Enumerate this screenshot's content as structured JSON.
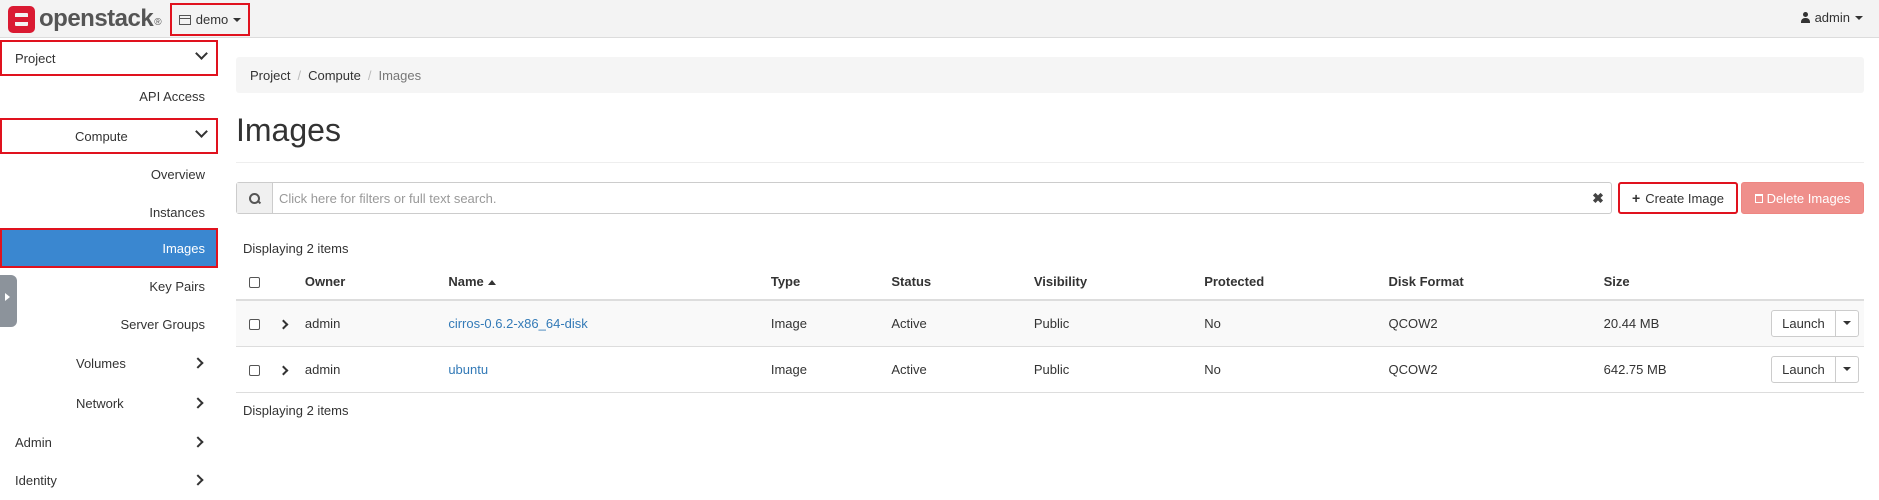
{
  "topbar": {
    "logo_text": "openstack",
    "logo_mark": "®",
    "project_label": "demo",
    "user_label": "admin"
  },
  "sidebar": {
    "project": "Project",
    "api_access": "API Access",
    "compute": "Compute",
    "items": [
      "Overview",
      "Instances",
      "Images",
      "Key Pairs",
      "Server Groups"
    ],
    "volumes": "Volumes",
    "network": "Network",
    "admin": "Admin",
    "identity": "Identity"
  },
  "breadcrumb": [
    "Project",
    "Compute",
    "Images"
  ],
  "page_title": "Images",
  "search": {
    "placeholder": "Click here for filters or full text search."
  },
  "actions": {
    "create": "Create Image",
    "delete": "Delete Images"
  },
  "display_count": "Displaying 2 items",
  "table": {
    "headers": [
      "Owner",
      "Name",
      "Type",
      "Status",
      "Visibility",
      "Protected",
      "Disk Format",
      "Size"
    ],
    "rows": [
      {
        "owner": "admin",
        "name": "cirros-0.6.2-x86_64-disk",
        "type": "Image",
        "status": "Active",
        "visibility": "Public",
        "protected": "No",
        "disk_format": "QCOW2",
        "size": "20.44 MB",
        "action": "Launch"
      },
      {
        "owner": "admin",
        "name": "ubuntu",
        "type": "Image",
        "status": "Active",
        "visibility": "Public",
        "protected": "No",
        "disk_format": "QCOW2",
        "size": "642.75 MB",
        "action": "Launch"
      }
    ]
  },
  "colors": {
    "brand": "#da1a32",
    "active_nav": "#3a87d0",
    "link": "#337ab7",
    "danger_button": "#ef8f8b",
    "highlight_box": "#e0121e"
  }
}
